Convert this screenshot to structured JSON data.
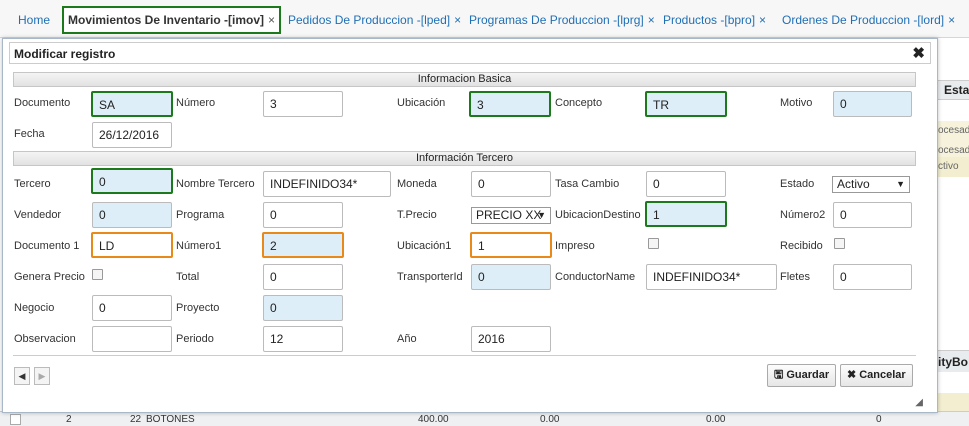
{
  "tabs": [
    {
      "label": "Home",
      "closable": false
    },
    {
      "label": "Movimientos De Inventario -[imov]",
      "closable": true,
      "active": true
    },
    {
      "label": "Pedidos De Produccion -[lped]",
      "closable": true
    },
    {
      "label": "Programas De Produccion -[lprg]",
      "closable": true
    },
    {
      "label": "Productos -[bpro]",
      "closable": true
    },
    {
      "label": "Ordenes De Produccion -[lord]",
      "closable": true
    }
  ],
  "tab_close_glyph": "×",
  "background": {
    "header_label": "Esta",
    "rows": [
      "ocesad",
      "ocesad",
      "ctivo"
    ],
    "header2_label": "ityBo",
    "bottom_row": {
      "col1": "2",
      "col2": "22",
      "col3": "BOTONES",
      "col4": "400.00",
      "col5": "0.00",
      "col6": "0.00",
      "col7": "0"
    }
  },
  "dialog": {
    "title": "Modificar registro",
    "close_glyph": "✖",
    "sections": {
      "basic": "Informacion Basica",
      "tercero": "Información Tercero"
    },
    "fields": {
      "documento": {
        "label": "Documento",
        "value": "SA"
      },
      "numero": {
        "label": "Número",
        "value": "3"
      },
      "ubicacion": {
        "label": "Ubicación",
        "value": "3"
      },
      "concepto": {
        "label": "Concepto",
        "value": "TR"
      },
      "motivo": {
        "label": "Motivo",
        "value": "0"
      },
      "fecha": {
        "label": "Fecha",
        "value": "26/12/2016"
      },
      "tercero": {
        "label": "Tercero",
        "value": "0"
      },
      "nombre_tercero": {
        "label": "Nombre Tercero",
        "value": "INDEFINIDO34*"
      },
      "moneda": {
        "label": "Moneda",
        "value": "0"
      },
      "tasa_cambio": {
        "label": "Tasa Cambio",
        "value": "0"
      },
      "estado": {
        "label": "Estado",
        "value": "Activo"
      },
      "vendedor": {
        "label": "Vendedor",
        "value": "0"
      },
      "programa": {
        "label": "Programa",
        "value": "0"
      },
      "tprecio": {
        "label": "T.Precio",
        "value": "PRECIO XX"
      },
      "ubicacion_destino": {
        "label": "UbicacionDestino",
        "value": "1"
      },
      "numero2": {
        "label": "Número2",
        "value": "0"
      },
      "documento1": {
        "label": "Documento 1",
        "value": "LD"
      },
      "numero1": {
        "label": "Número1",
        "value": "2"
      },
      "ubicacion1": {
        "label": "Ubicación1",
        "value": "1"
      },
      "impreso": {
        "label": "Impreso",
        "checked": false
      },
      "recibido": {
        "label": "Recibido",
        "checked": false
      },
      "genera_precio": {
        "label": "Genera Precio",
        "checked": false
      },
      "total": {
        "label": "Total",
        "value": "0"
      },
      "transporter_id": {
        "label": "TransporterId",
        "value": "0"
      },
      "conductor_name": {
        "label": "ConductorName",
        "value": "INDEFINIDO34*"
      },
      "fletes": {
        "label": "Fletes",
        "value": "0"
      },
      "negocio": {
        "label": "Negocio",
        "value": "0"
      },
      "proyecto": {
        "label": "Proyecto",
        "value": "0"
      },
      "observacion": {
        "label": "Observacion",
        "value": ""
      },
      "periodo": {
        "label": "Periodo",
        "value": "12"
      },
      "anio": {
        "label": "Año",
        "value": "2016"
      }
    },
    "buttons": {
      "save": "Guardar",
      "cancel": "Cancelar"
    }
  },
  "colors": {
    "highlight_green": "#1c7a1c",
    "highlight_orange": "#e8891a",
    "readonly_bg": "#deeef8",
    "link": "#1f6fb5"
  }
}
